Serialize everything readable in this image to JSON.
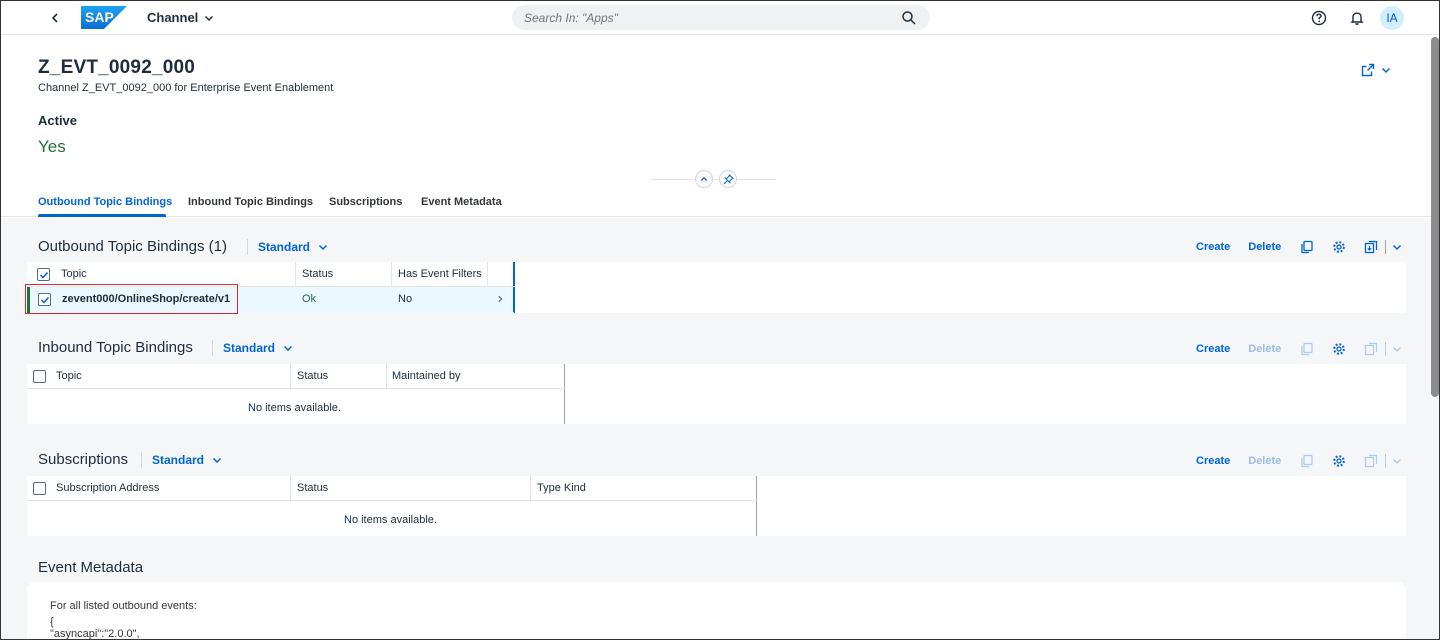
{
  "shell": {
    "app_title": "Channel",
    "search_placeholder": "Search In: \"Apps\"",
    "avatar_initials": "IA"
  },
  "header": {
    "title": "Z_EVT_0092_000",
    "subtitle": "Channel Z_EVT_0092_000 for Enterprise Event Enablement",
    "active_label": "Active",
    "active_value": "Yes"
  },
  "tabs": [
    {
      "label": "Outbound Topic Bindings",
      "selected": true
    },
    {
      "label": "Inbound Topic Bindings",
      "selected": false
    },
    {
      "label": "Subscriptions",
      "selected": false
    },
    {
      "label": "Event Metadata",
      "selected": false
    }
  ],
  "outbound": {
    "title": "Outbound Topic Bindings (1)",
    "variant": "Standard",
    "create_label": "Create",
    "delete_label": "Delete",
    "columns": [
      "Topic",
      "Status",
      "Has Event Filters"
    ],
    "rows": [
      {
        "topic": "zevent000/OnlineShop/create/v1",
        "status": "Ok",
        "has_event_filters": "No"
      }
    ]
  },
  "inbound": {
    "title": "Inbound Topic Bindings",
    "variant": "Standard",
    "create_label": "Create",
    "delete_label": "Delete",
    "columns": [
      "Topic",
      "Status",
      "Maintained by"
    ],
    "empty_text": "No items available."
  },
  "subscriptions": {
    "title": "Subscriptions",
    "variant": "Standard",
    "create_label": "Create",
    "delete_label": "Delete",
    "columns": [
      "Subscription Address",
      "Status",
      "Type Kind"
    ],
    "empty_text": "No items available."
  },
  "event_metadata": {
    "title": "Event Metadata",
    "lines": [
      "For all listed outbound events:",
      "{",
      "\"asyncapi\":\"2.0.0\","
    ]
  },
  "colors": {
    "accent": "#0064d9",
    "positive": "#256f3a",
    "highlight_border": "#d92b2b"
  }
}
